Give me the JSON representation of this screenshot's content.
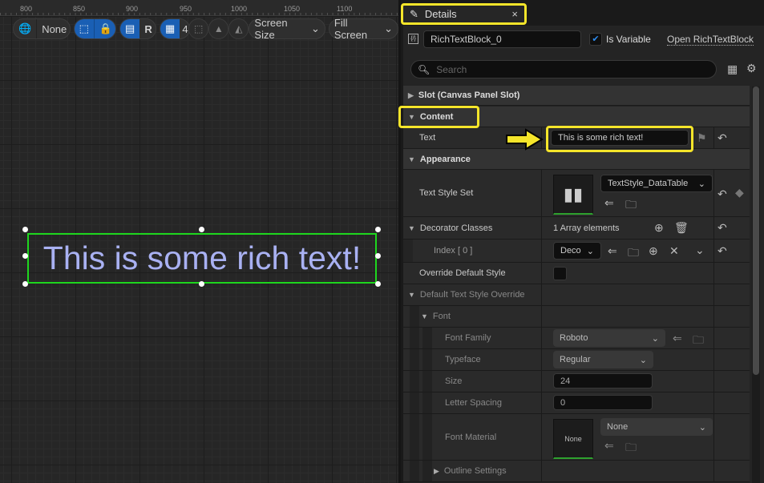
{
  "ruler": {
    "ticks": [
      "800",
      "850",
      "900",
      "950",
      "1000",
      "1050",
      "1100"
    ]
  },
  "toolbar": {
    "world_label": "None",
    "respect_label": "R",
    "grid_size": "4",
    "screen_size": "Screen Size",
    "fill_screen": "Fill Screen"
  },
  "canvas": {
    "text": "This is some rich text!",
    "text_color": "#a9b1f2",
    "selection_color": "#1ed61e"
  },
  "details": {
    "tab_title": "Details",
    "close": "×",
    "widget_name": "RichTextBlock_0",
    "is_variable_label": "Is Variable",
    "is_variable": true,
    "open_link": "Open RichTextBlock",
    "search_placeholder": "Search",
    "slot": "Slot (Canvas Panel Slot)",
    "content": "Content",
    "text_label": "Text",
    "text_value": "This is some rich text!",
    "appearance": "Appearance",
    "text_style_set_label": "Text Style Set",
    "text_style_set_value": "TextStyle_DataTable",
    "decorator_label": "Decorator Classes",
    "decorator_count": "1 Array elements",
    "index_label": "Index [ 0 ]",
    "index_value": "Deco",
    "override_label": "Override Default Style",
    "override_checked": false,
    "default_override": "Default Text Style Override",
    "font": "Font",
    "font_family_label": "Font Family",
    "font_family": "Roboto",
    "typeface_label": "Typeface",
    "typeface": "Regular",
    "size_label": "Size",
    "size": "24",
    "letter_spacing_label": "Letter Spacing",
    "letter_spacing": "0",
    "font_material_label": "Font Material",
    "font_material": "None",
    "font_material_thumb": "None",
    "outline": "Outline Settings"
  },
  "highlight_color": "#f5e52a"
}
